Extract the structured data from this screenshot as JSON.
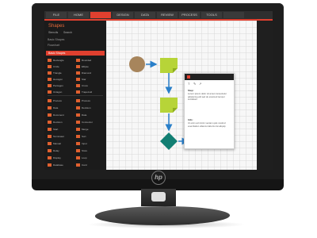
{
  "brand": "hp",
  "ribbon": {
    "tabs": [
      "FILE",
      "HOME",
      "",
      "DESIGN",
      "DATA",
      "REVIEW",
      "PROCESS",
      "TOOLS",
      ""
    ],
    "active_index": 2
  },
  "sidebar": {
    "title": "Shapes",
    "sub_left": "Stencils",
    "sub_right": "Search",
    "lines": [
      "Basic Shapes",
      "Flowchart"
    ],
    "selected": "Basic Shapes",
    "shapes_group1": [
      "Rectangle",
      "Circle",
      "Triangle",
      "Hexagon",
      "Pentagon",
      "Octagon"
    ],
    "shapes_group1_right": [
      "Rounded",
      "Ellipse",
      "Diamond",
      "Star",
      "Cross",
      "Trapezoid"
    ],
    "shapes_group2": [
      "Process",
      "Data",
      "Document",
      "Decision",
      "Start",
      "Terminator",
      "Manual",
      "Delay",
      "Display",
      "Database"
    ],
    "shapes_group2_right": [
      "Process",
      "Decision",
      "Data",
      "Connector",
      "Merge",
      "Sort",
      "Input",
      "Store",
      "Loop",
      "Card"
    ]
  },
  "notes": {
    "tools": [
      "T",
      "✎",
      "↗"
    ],
    "marks": [
      "Step:",
      "Info:"
    ],
    "paragraphs": [
      "Lorem ipsum dolor sit amet consectetur adipiscing elit sed do eiusmod tempor incididunt",
      "Ut enim ad minim veniam quis nostrud exercitation ullamco laboris nisi aliquip"
    ]
  },
  "colors": {
    "accent": "#e0402f",
    "circle": "#a7855c",
    "note_shape": "#b7d438",
    "diamond": "#127f73",
    "arrow": "#2a7fc9"
  }
}
